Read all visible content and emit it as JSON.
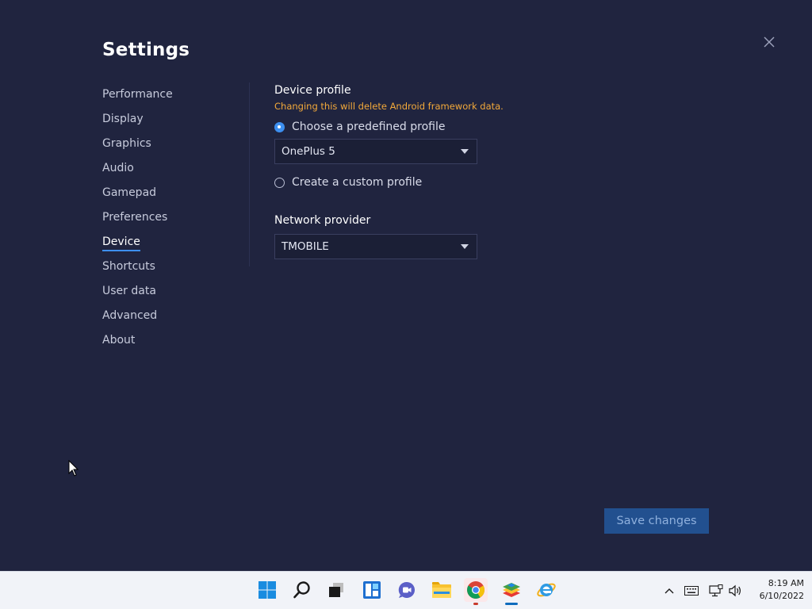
{
  "window": {
    "title": "Settings"
  },
  "sidebar": {
    "items": [
      {
        "label": "Performance"
      },
      {
        "label": "Display"
      },
      {
        "label": "Graphics"
      },
      {
        "label": "Audio"
      },
      {
        "label": "Gamepad"
      },
      {
        "label": "Preferences"
      },
      {
        "label": "Device"
      },
      {
        "label": "Shortcuts"
      },
      {
        "label": "User data"
      },
      {
        "label": "Advanced"
      },
      {
        "label": "About"
      }
    ],
    "active": "Device"
  },
  "device_profile": {
    "title": "Device profile",
    "warning": "Changing this will delete Android framework data.",
    "option_predefined": "Choose a predefined profile",
    "option_predefined_checked": true,
    "selected_profile": "OnePlus 5",
    "option_custom": "Create a custom profile",
    "option_custom_checked": false
  },
  "network": {
    "title": "Network provider",
    "selected": "TMOBILE"
  },
  "actions": {
    "save_label": "Save changes"
  },
  "colors": {
    "background": "#20243f",
    "accent": "#3d8ff0",
    "warning": "#f3a93a",
    "save_button": "#22508f"
  },
  "taskbar": {
    "icons": [
      "windows-start-icon",
      "search-icon",
      "task-view-icon",
      "widgets-icon",
      "chat-icon",
      "file-explorer-icon",
      "chrome-icon",
      "bluestacks-icon",
      "internet-explorer-icon"
    ],
    "time": "8:19 AM",
    "date": "6/10/2022"
  }
}
